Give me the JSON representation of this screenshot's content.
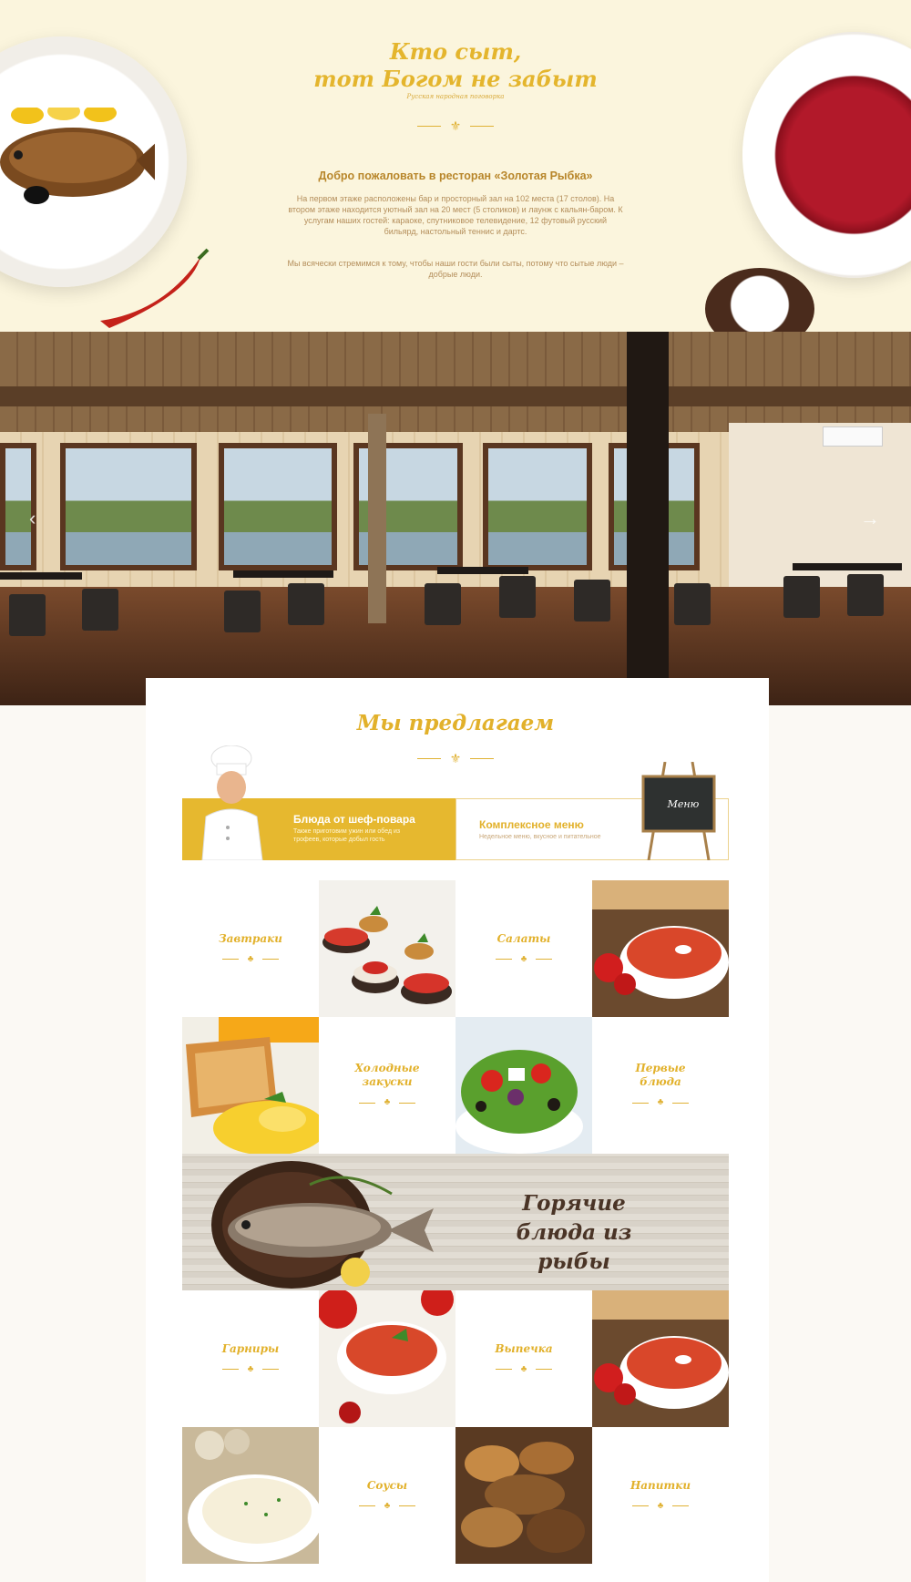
{
  "hero": {
    "title_line1": "Кто сыт,",
    "title_line2": "тот Богом не забыт",
    "caption": "Русская народная поговорка",
    "welcome_title": "Добро пожаловать в ресторан «Золотая Рыбка»",
    "welcome_text": "На первом этаже расположены бар и просторный зал на 102 места (17 столов). На втором этаже находится уютный зал на 20 мест (5 столиков) и лаунж с кальян-баром. К услугам наших гостей: караоке, спутниковое телевидение, 12 футовый русский бильярд, настольный теннис и дартс.",
    "welcome_text2": "Мы всячески стремимся к тому, чтобы наши гости были сыты, потому что сытые люди – добрые люди."
  },
  "slider": {
    "prev_icon": "‹",
    "next_icon": "→"
  },
  "offer": {
    "title": "Мы предлагаем",
    "chef_title": "Блюда от шеф-повара",
    "chef_sub": "Также приготовим ужин или обед из трофеев, которые добыл гость",
    "menu_title": "Комплексное меню",
    "menu_sub": "Недельное меню, вкусное и питательное",
    "easel_text": "Меню"
  },
  "categories": {
    "breakfast": "Завтраки",
    "salads": "Салаты",
    "cold": "Холодные\nзакуски",
    "first": "Первые\nблюда",
    "fish_line1": "Горячие",
    "fish_line2": "блюда из рыбы",
    "garnish": "Гарниры",
    "bakery": "Выпечка",
    "sauces": "Соусы",
    "drinks": "Напитки"
  },
  "colors": {
    "accent": "#e2b12b",
    "hero_bg": "#fbf5dd",
    "text_brown": "#b48e5b"
  },
  "icons": {
    "ornament": "fleur-de-lis-icon"
  }
}
